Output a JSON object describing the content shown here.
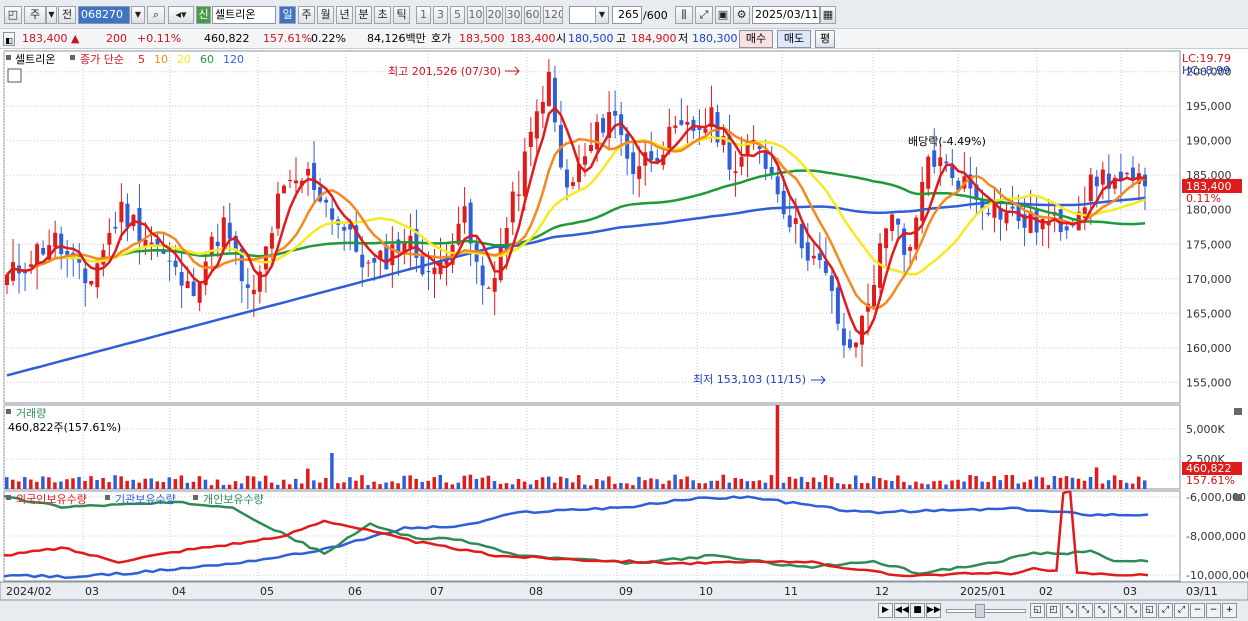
{
  "toolbar": {
    "market": "주",
    "prev": "전",
    "code": "068270",
    "stock_badge": "신",
    "stock_name": "셀트리온",
    "periods": [
      "일",
      "주",
      "월",
      "년",
      "분",
      "초",
      "틱"
    ],
    "active_period": "일",
    "intervals": [
      "1",
      "3",
      "5",
      "10",
      "20",
      "30",
      "60",
      "120"
    ],
    "count": "265",
    "count_total": "/600",
    "date": "2025/03/11"
  },
  "quote": {
    "price": "183,400",
    "arrow": "▲",
    "change": "200",
    "change_pct": "+0.11%",
    "volume": "460,822",
    "volume_pct": "157.61%",
    "turnover": "0.22%",
    "amount": "84,126백만",
    "bid_label": "호가",
    "bid": "183,500",
    "ask": "183,400",
    "open_label": "시",
    "open": "180,500",
    "high_label": "고",
    "high": "184,900",
    "low_label": "저",
    "low": "180,300",
    "buy": "매수",
    "sell": "매도",
    "avg": "평"
  },
  "price_panel": {
    "legend_stock": "셀트리온",
    "legend_ma": "종가 단순",
    "ma_periods": [
      "5",
      "10",
      "20",
      "60",
      "120"
    ],
    "ma_colors": [
      "#e01b1b",
      "#f5891f",
      "#f5ea1e",
      "#1f9a38",
      "#2f5fd8"
    ],
    "lc_label": "LC:19.79",
    "hc_label": "HC:-8.99",
    "max_label": "최고 201,526 (07/30)",
    "min_label": "최저 153,103 (11/15)",
    "dividend_label": "배당락(-4.49%)",
    "current_price_tag": "183,400",
    "current_pct_tag": "0.11%",
    "yticks": [
      "200,000",
      "195,000",
      "190,000",
      "185,000",
      "180,000",
      "175,000",
      "170,000",
      "165,000",
      "160,000",
      "155,000"
    ]
  },
  "volume_panel": {
    "title": "거래량",
    "summary": "460,822주(157.61%)",
    "yticks": [
      "5,000K",
      "2,500K"
    ],
    "tag_value": "460,822",
    "tag_pct": "157.61%"
  },
  "holding_panel": {
    "legend": [
      "외국인보유수량",
      "기관보유수량",
      "개인보유수량"
    ],
    "colors": [
      "#e01b1b",
      "#2f5fd8",
      "#2e8b57"
    ],
    "yticks": [
      "-6,000,000",
      "-8,000,000",
      "-10,000,000"
    ]
  },
  "xaxis": {
    "labels": [
      "2024/02",
      "03",
      "04",
      "05",
      "06",
      "07",
      "08",
      "09",
      "10",
      "11",
      "12",
      "2025/01",
      "02",
      "03"
    ],
    "right_label": "03/11"
  },
  "chart_data": [
    {
      "type": "candlestick",
      "title": "셀트리온",
      "series_names": [
        "5",
        "10",
        "20",
        "60",
        "120"
      ],
      "ylim": [
        152000,
        203000
      ],
      "high": 201526,
      "high_date": "07/30",
      "low": 153103,
      "low_date": "11/15",
      "close_path": [
        [
          0,
          170000
        ],
        [
          0.04,
          176000
        ],
        [
          0.07,
          169000
        ],
        [
          0.1,
          180000
        ],
        [
          0.13,
          175000
        ],
        [
          0.16,
          168000
        ],
        [
          0.19,
          178000
        ],
        [
          0.215,
          166000
        ],
        [
          0.24,
          182000
        ],
        [
          0.265,
          185000
        ],
        [
          0.3,
          176000
        ],
        [
          0.32,
          171000
        ],
        [
          0.35,
          176000
        ],
        [
          0.375,
          170000
        ],
        [
          0.4,
          180000
        ],
        [
          0.42,
          167000
        ],
        [
          0.44,
          178000
        ],
        [
          0.46,
          190000
        ],
        [
          0.475,
          200000
        ],
        [
          0.49,
          182000
        ],
        [
          0.51,
          188000
        ],
        [
          0.53,
          195000
        ],
        [
          0.55,
          186000
        ],
        [
          0.58,
          190000
        ],
        [
          0.62,
          193000
        ],
        [
          0.64,
          186000
        ],
        [
          0.66,
          190000
        ],
        [
          0.69,
          178000
        ],
        [
          0.72,
          170000
        ],
        [
          0.74,
          158000
        ],
        [
          0.755,
          166000
        ],
        [
          0.78,
          182000
        ],
        [
          0.79,
          170000
        ],
        [
          0.81,
          188000
        ],
        [
          0.84,
          184000
        ],
        [
          0.87,
          180000
        ],
        [
          0.9,
          178000
        ],
        [
          0.93,
          178000
        ],
        [
          0.96,
          185000
        ],
        [
          0.99,
          183400
        ]
      ]
    },
    {
      "type": "bar",
      "title": "거래량",
      "ylim": [
        0,
        7000000
      ]
    },
    {
      "type": "line",
      "series_names": [
        "외국인보유수량",
        "기관보유수량",
        "개인보유수량"
      ],
      "ylim": [
        -10300000,
        -5700000
      ]
    }
  ]
}
